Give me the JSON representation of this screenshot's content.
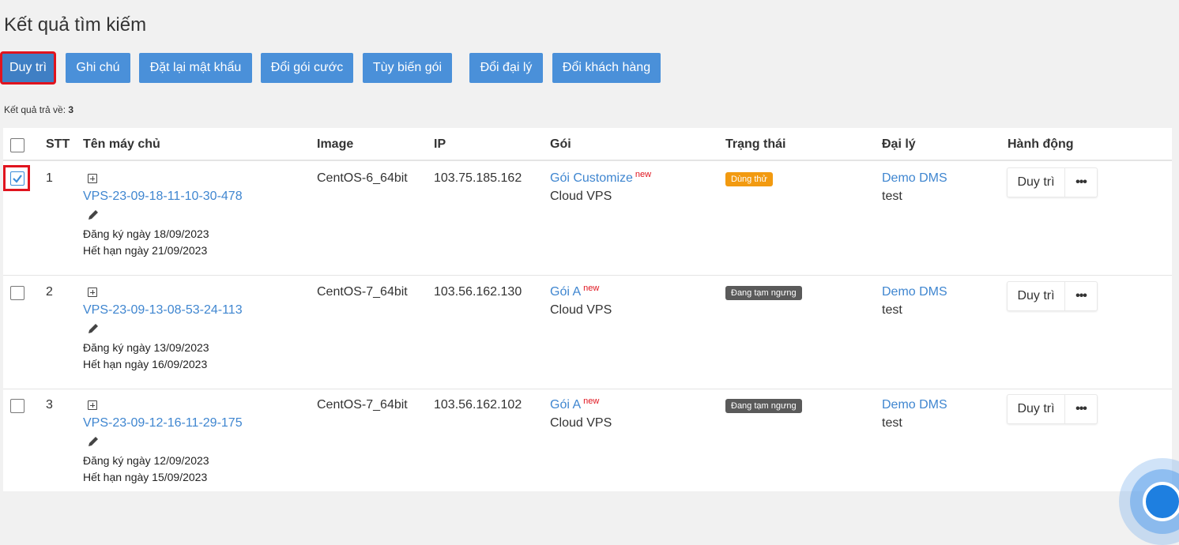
{
  "page": {
    "title": "Kết quả tìm kiếm"
  },
  "toolbar": {
    "buttons": [
      {
        "label": "Duy trì",
        "active": true
      },
      {
        "label": "Ghi chú"
      },
      {
        "label": "Đặt lại mật khẩu"
      },
      {
        "label": "Đổi gói cước"
      },
      {
        "label": "Tùy biến gói"
      },
      {
        "label": "Đổi đại lý"
      },
      {
        "label": "Đổi khách hàng"
      }
    ]
  },
  "results": {
    "prefix": "Kết quả trả về:",
    "count": "3"
  },
  "table": {
    "headers": {
      "stt": "STT",
      "name": "Tên máy chủ",
      "image": "Image",
      "ip": "IP",
      "plan": "Gói",
      "status": "Trạng thái",
      "agent": "Đại lý",
      "action": "Hành động"
    },
    "rows": [
      {
        "stt": "1",
        "checked": true,
        "name": "VPS-23-09-18-11-10-30-478",
        "registered": "Đăng ký ngày 18/09/2023",
        "expires": "Hết hạn ngày 21/09/2023",
        "image": "CentOS-6_64bit",
        "ip": "103.75.185.162",
        "plan": "Gói Customize",
        "plan_tag": "new",
        "plan_type": "Cloud VPS",
        "status": "Dùng thử",
        "agent": "Demo DMS",
        "customer": "test",
        "action": "Duy trì",
        "more": "•••"
      },
      {
        "stt": "2",
        "checked": false,
        "name": "VPS-23-09-13-08-53-24-113",
        "registered": "Đăng ký ngày 13/09/2023",
        "expires": "Hết hạn ngày 16/09/2023",
        "image": "CentOS-7_64bit",
        "ip": "103.56.162.130",
        "plan": "Gói A",
        "plan_tag": "new",
        "plan_type": "Cloud VPS",
        "status": "Đang tạm ngưng",
        "agent": "Demo DMS",
        "customer": "test",
        "action": "Duy trì",
        "more": "•••"
      },
      {
        "stt": "3",
        "checked": false,
        "name": "VPS-23-09-12-16-11-29-175",
        "registered": "Đăng ký ngày 12/09/2023",
        "expires": "Hết hạn ngày 15/09/2023",
        "image": "CentOS-7_64bit",
        "ip": "103.56.162.102",
        "plan": "Gói A",
        "plan_tag": "new",
        "plan_type": "Cloud VPS",
        "status": "Đang tạm ngưng",
        "agent": "Demo DMS",
        "customer": "test",
        "action": "Duy trì",
        "more": "•••"
      }
    ]
  },
  "colors": {
    "primary_button": "#4a90d9",
    "highlight": "#e0141e",
    "link": "#3f86d0",
    "trial_badge": "#f29a10",
    "paused_badge": "#5a5a5a"
  }
}
